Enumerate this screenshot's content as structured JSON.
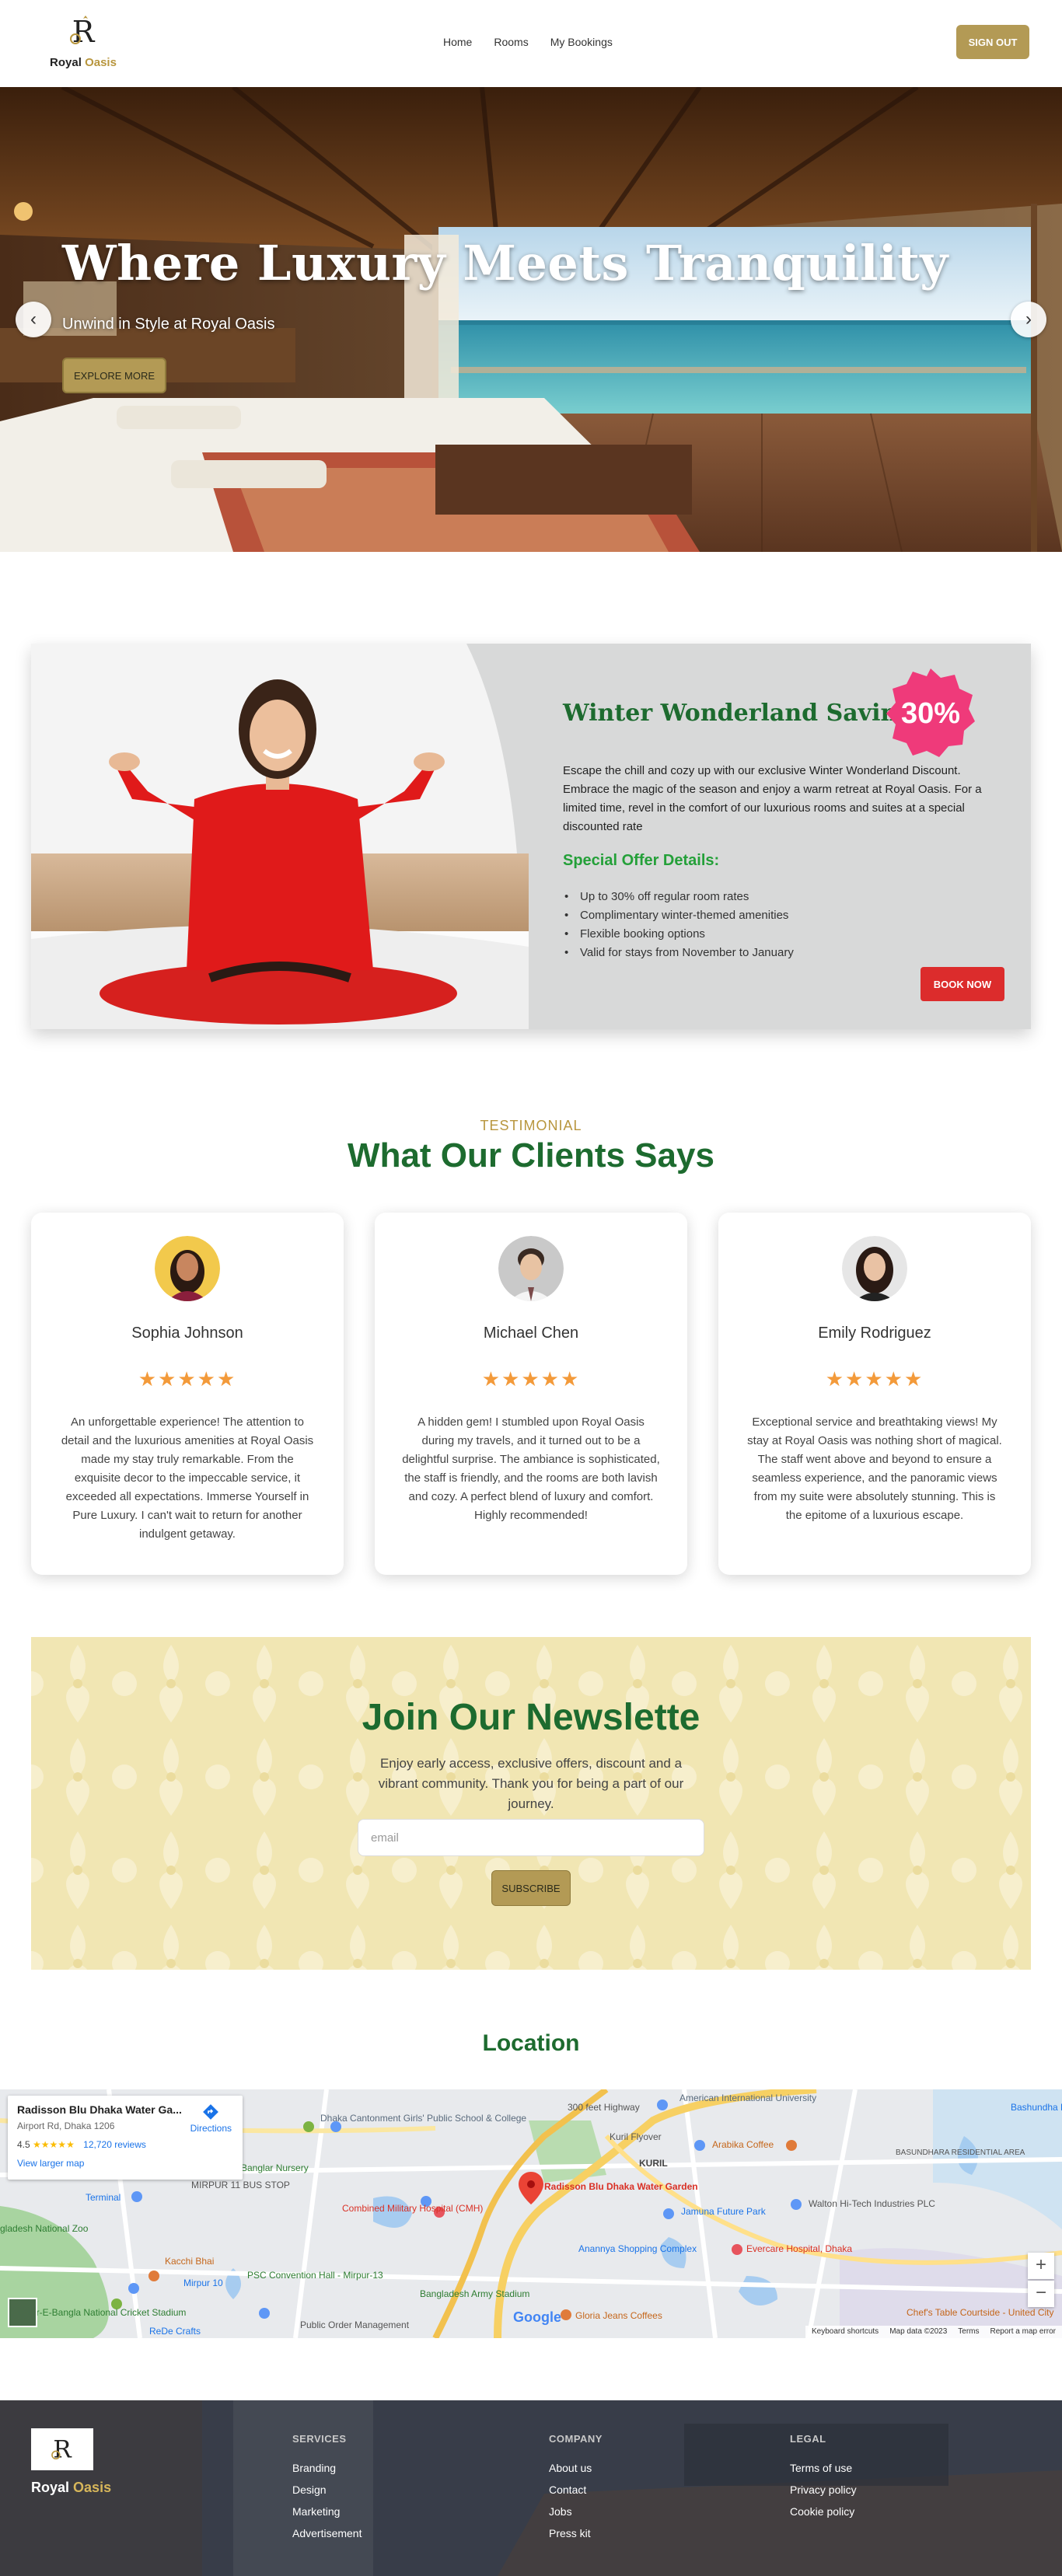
{
  "brand": {
    "name_primary": "Royal",
    "name_accent": "Oasis",
    "accent_color": "#b8963e"
  },
  "nav": {
    "links": [
      "Home",
      "Rooms",
      "My Bookings"
    ],
    "signout_label": "SIGN OUT"
  },
  "hero": {
    "title": "Where Luxury Meets Tranquility",
    "subtitle": "Unwind in Style at Royal Oasis",
    "cta_label": "EXPLORE MORE",
    "prev_icon": "‹",
    "next_icon": "›"
  },
  "offer": {
    "title": "Winter Wonderland Savings!",
    "badge": "30%",
    "description": "Escape the chill and cozy up with our exclusive Winter Wonderland Discount. Embrace the magic of the season and enjoy a warm retreat at Royal Oasis. For a limited time, revel in the comfort of our luxurious rooms and suites at a special discounted rate",
    "details_title": "Special Offer Details:",
    "details": [
      "Up to 30% off regular room rates",
      "Complimentary winter-themed amenities",
      "Flexible booking options",
      "Valid for stays from November to January"
    ],
    "cta_label": "BOOK NOW"
  },
  "testimonials": {
    "label": "TESTIMONIAL",
    "heading": "What Our Clients Says",
    "items": [
      {
        "name": "Sophia Johnson",
        "rating": 5,
        "stars": "★★★★★",
        "text": "An unforgettable experience! The attention to detail and the luxurious amenities at Royal Oasis made my stay truly remarkable. From the exquisite decor to the impeccable service, it exceeded all expectations. Immerse Yourself in Pure Luxury. I can't wait to return for another indulgent getaway."
      },
      {
        "name": "Michael Chen",
        "rating": 5,
        "stars": "★★★★★",
        "text": "A hidden gem! I stumbled upon Royal Oasis during my travels, and it turned out to be a delightful surprise. The ambiance is sophisticated, the staff is friendly, and the rooms are both lavish and cozy. A perfect blend of luxury and comfort. Highly recommended!"
      },
      {
        "name": "Emily Rodriguez",
        "rating": 5,
        "stars": "★★★★★",
        "text": "Exceptional service and breathtaking views! My stay at Royal Oasis was nothing short of magical. The staff went above and beyond to ensure a seamless experience, and the panoramic views from my suite were absolutely stunning. This is the epitome of a luxurious escape."
      }
    ]
  },
  "newsletter": {
    "title": "Join Our Newslette",
    "text": "Enjoy early access, exclusive offers, discount and a vibrant community. Thank you for being a part of our journey.",
    "input_placeholder": "email",
    "button_label": "SUBSCRIBE"
  },
  "location": {
    "title": "Location",
    "card": {
      "title": "Radisson Blu Dhaka Water Ga...",
      "address": "Airport Rd, Dhaka 1206",
      "rating": "4.5",
      "stars": "★★★★★",
      "reviews": "12,720 reviews",
      "larger_map": "View larger map",
      "directions": "Directions"
    },
    "places": {
      "p1": "Dhaka Cantonment Girls' Public School & College",
      "p2": "Banglar Nursery",
      "p3": "MIRPUR 11 BUS STOP",
      "p4": "Terminal",
      "p5": "gladesh National Zoo",
      "p6": "Kacchi Bhai",
      "p7": "Mirpur 10",
      "p8": "PSC Convention Hall - Mirpur-13",
      "p9": "er-E-Bangla National Cricket Stadium",
      "p10": "ReDe Crafts",
      "p11": "Combined Military Hospital (CMH)",
      "p12": "Radisson Blu Dhaka Water Garden",
      "p13": "Kuril Flyover",
      "p14": "300 feet Highway",
      "p15": "American International University",
      "p16": "Arabika Coffee",
      "p17": "KURIL",
      "p18": "Jamuna Future Park",
      "p19": "Walton Hi-Tech Industries PLC",
      "p20": "BASUNDHARA RESIDENTIAL AREA",
      "p21": "Evercare Hospital, Dhaka",
      "p22": "Anannya Shopping Complex",
      "p23": "Bangladesh Army Stadium",
      "p24": "Gloria Jeans Coffees",
      "p25": "Public Order Management",
      "p26": "Chef's Table Courtside - United City",
      "p27": "Bashundha Kings Are"
    },
    "footer_items": [
      "Keyboard shortcuts",
      "Map data ©2023",
      "Terms",
      "Report a map error"
    ],
    "zoom_in": "+",
    "zoom_out": "−",
    "google": "Google"
  },
  "footer": {
    "brand_primary": "Royal",
    "brand_accent": "Oasis",
    "columns": [
      {
        "title": "SERVICES",
        "links": [
          "Branding",
          "Design",
          "Marketing",
          "Advertisement"
        ]
      },
      {
        "title": "COMPANY",
        "links": [
          "About us",
          "Contact",
          "Jobs",
          "Press kit"
        ]
      },
      {
        "title": "LEGAL",
        "links": [
          "Terms of use",
          "Privacy policy",
          "Cookie policy"
        ]
      }
    ]
  }
}
